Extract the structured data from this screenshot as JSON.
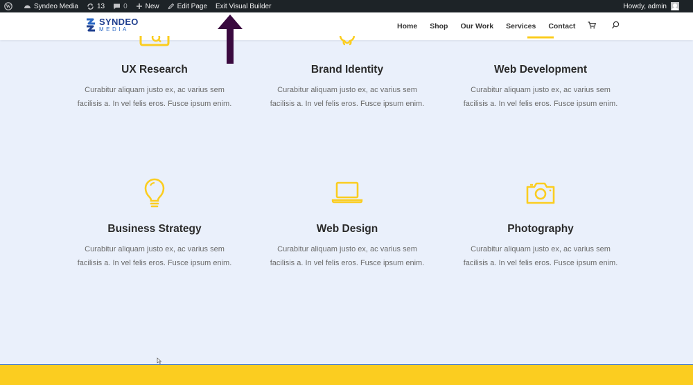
{
  "adminbar": {
    "site_name": "Syndeo Media",
    "updates_count": "13",
    "comments_count": "0",
    "new_label": "New",
    "edit_page_label": "Edit Page",
    "exit_builder_label": "Exit Visual Builder",
    "howdy_label": "Howdy, admin"
  },
  "logo": {
    "line1": "SYNDEO",
    "line2": "MEDIA"
  },
  "nav": {
    "items": [
      "Home",
      "Shop",
      "Our Work",
      "Services",
      "Contact"
    ]
  },
  "services": [
    {
      "title": "UX Research",
      "description": "Curabitur aliquam justo ex, ac varius sem facilisis a. In vel felis eros. Fusce ipsum enim.",
      "icon": "search-icon"
    },
    {
      "title": "Brand Identity",
      "description": "Curabitur aliquam justo ex, ac varius sem facilisis a. In vel felis eros. Fusce ipsum enim.",
      "icon": "lightbulb-icon"
    },
    {
      "title": "Web Development",
      "description": "Curabitur aliquam justo ex, ac varius sem facilisis a. In vel felis eros. Fusce ipsum enim.",
      "icon": "laptop-icon"
    },
    {
      "title": "Business Strategy",
      "description": "Curabitur aliquam justo ex, ac varius sem facilisis a. In vel felis eros. Fusce ipsum enim.",
      "icon": "lightbulb-icon"
    },
    {
      "title": "Web Design",
      "description": "Curabitur aliquam justo ex, ac varius sem facilisis a. In vel felis eros. Fusce ipsum enim.",
      "icon": "laptop-icon"
    },
    {
      "title": "Photography",
      "description": "Curabitur aliquam justo ex, ac varius sem facilisis a. In vel felis eros. Fusce ipsum enim.",
      "icon": "camera-icon"
    }
  ],
  "colors": {
    "accent": "#fbcd20",
    "adminbar_bg": "#1d2327",
    "page_bg": "#eaf0fb",
    "annotation_arrow": "#3a0a3f"
  }
}
